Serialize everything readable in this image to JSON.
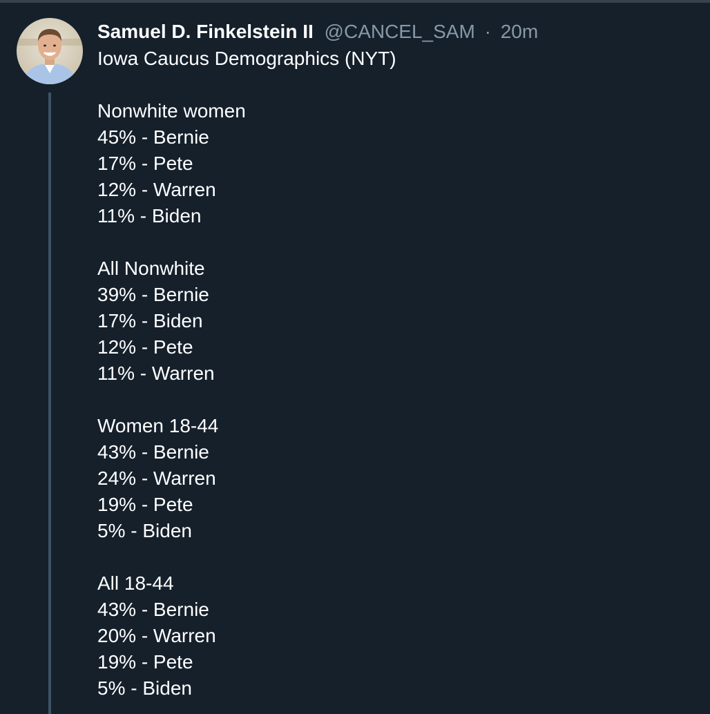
{
  "tweet": {
    "display_name": "Samuel D. Finkelstein II",
    "handle": "@CANCEL_SAM",
    "separator": "·",
    "time": "20m",
    "lines": [
      "Iowa Caucus Demographics (NYT)",
      "",
      "Nonwhite women",
      "45% - Bernie",
      "17% - Pete",
      "12% - Warren",
      "11% - Biden",
      "",
      "All Nonwhite",
      "39% - Bernie",
      "17% - Biden",
      "12% - Pete",
      "11% - Warren",
      "",
      "Women 18-44",
      "43% - Bernie",
      "24% - Warren",
      "19% - Pete",
      "5% - Biden",
      "",
      "All 18-44",
      "43% - Bernie",
      "20% - Warren",
      "19% - Pete",
      "5% - Biden"
    ]
  },
  "colors": {
    "background": "#15202b",
    "text": "#ffffff",
    "secondary_text": "#8899a6",
    "thread_line": "#3d5466"
  }
}
